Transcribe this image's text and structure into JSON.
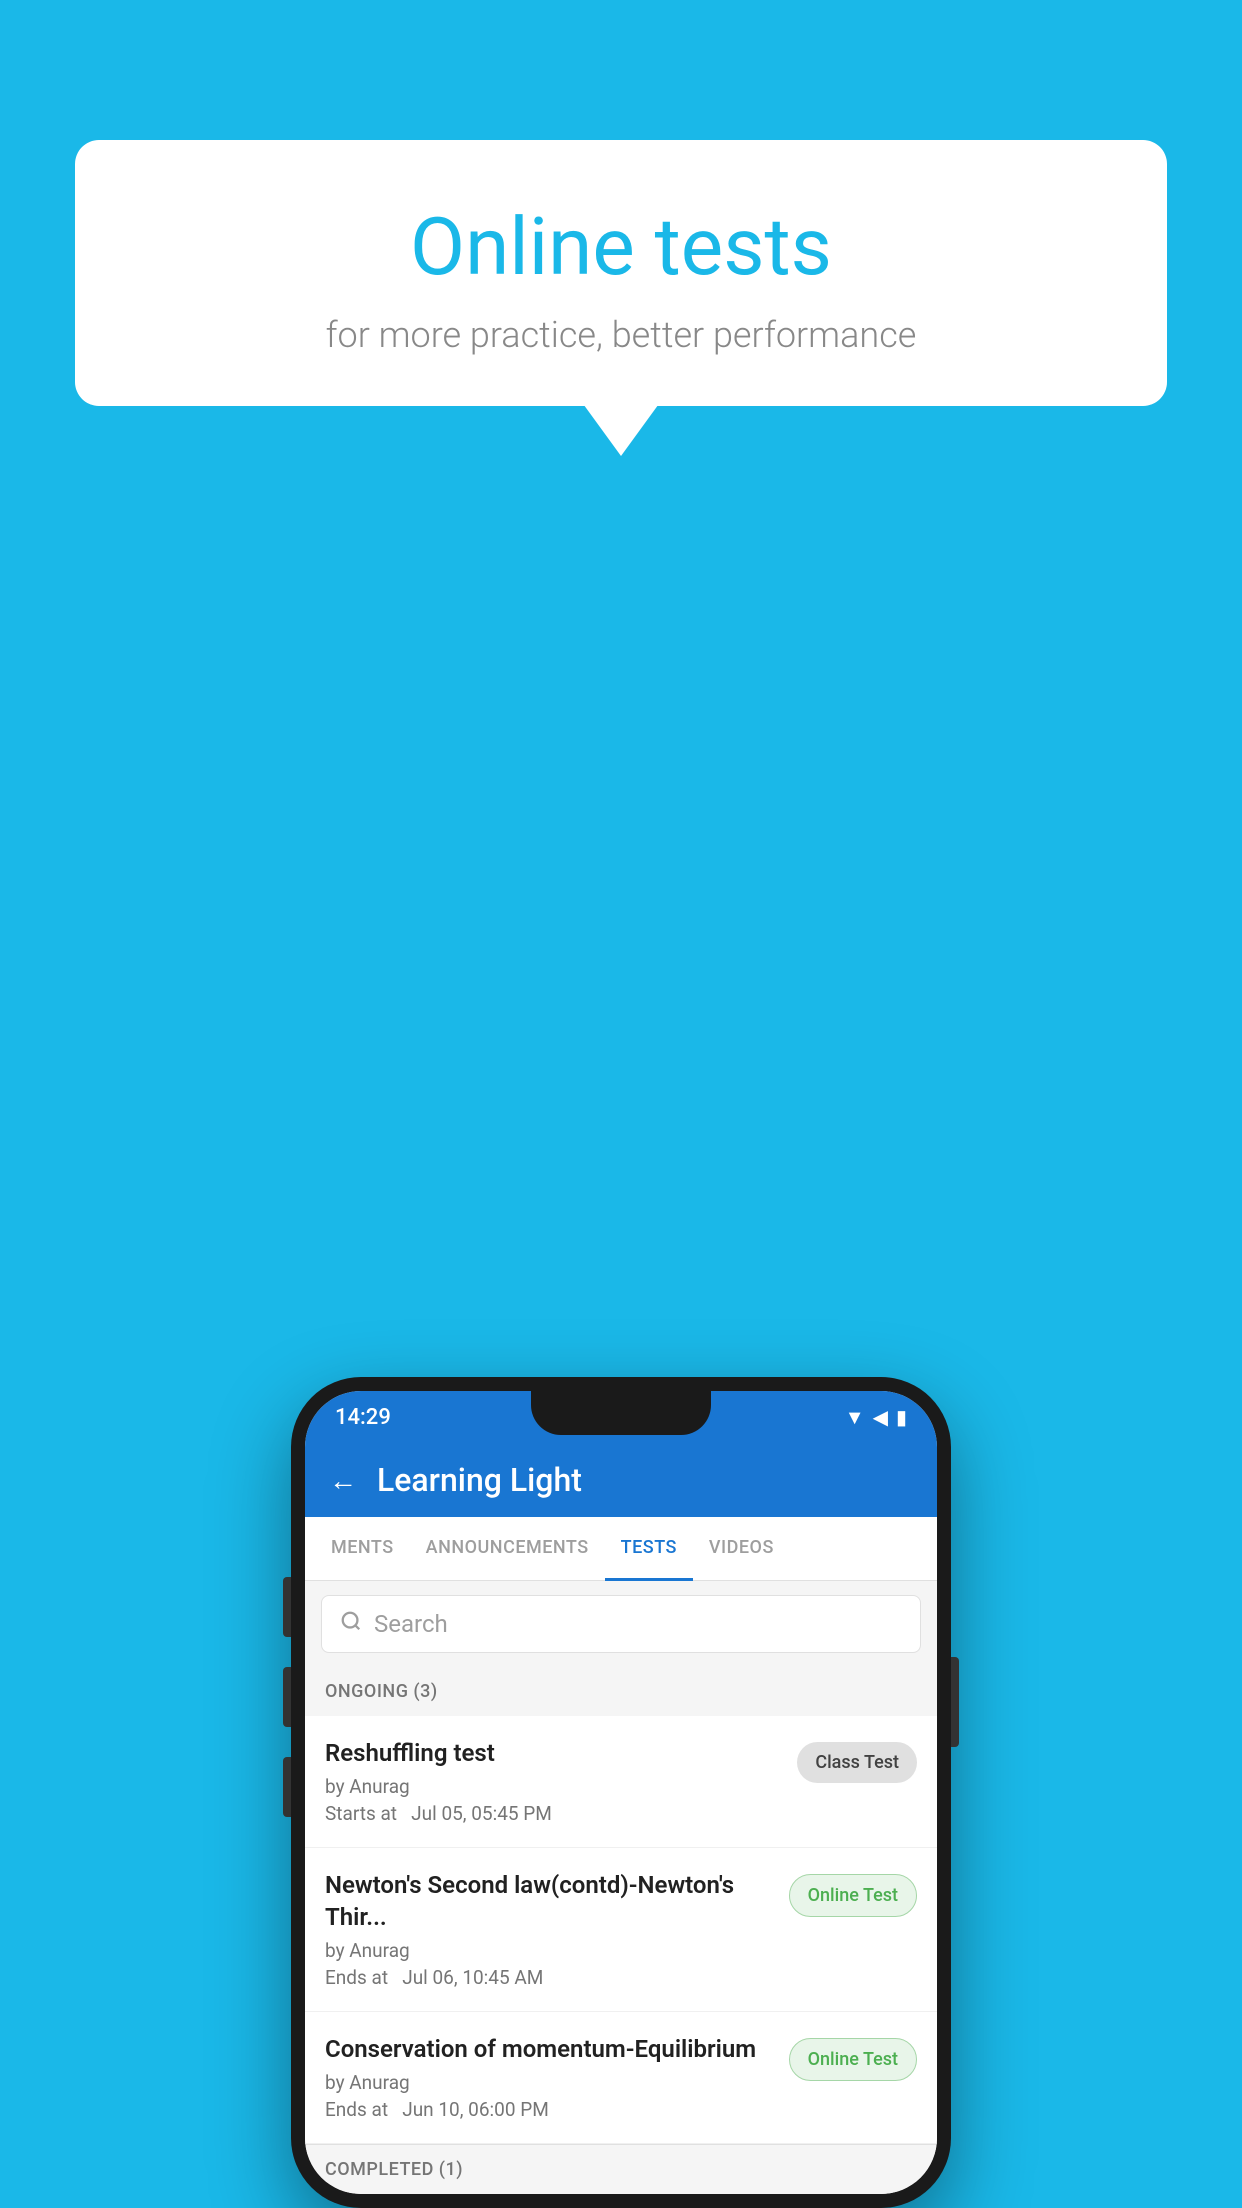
{
  "background": {
    "color": "#1ab8e8"
  },
  "speech_bubble": {
    "title": "Online tests",
    "subtitle": "for more practice, better performance"
  },
  "phone": {
    "status_bar": {
      "time": "14:29",
      "icons": "▼ ◀ ▮"
    },
    "app_header": {
      "back_label": "←",
      "title": "Learning Light"
    },
    "tabs": [
      {
        "label": "MENTS",
        "active": false
      },
      {
        "label": "ANNOUNCEMENTS",
        "active": false
      },
      {
        "label": "TESTS",
        "active": true
      },
      {
        "label": "VIDEOS",
        "active": false
      }
    ],
    "search": {
      "placeholder": "Search"
    },
    "ongoing_section": {
      "title": "ONGOING (3)"
    },
    "tests": [
      {
        "name": "Reshuffling test",
        "author": "by Anurag",
        "time": "Starts at  Jul 05, 05:45 PM",
        "badge": "Class Test",
        "badge_type": "class"
      },
      {
        "name": "Newton's Second law(contd)-Newton's Thir...",
        "author": "by Anurag",
        "time": "Ends at  Jul 06, 10:45 AM",
        "badge": "Online Test",
        "badge_type": "online"
      },
      {
        "name": "Conservation of momentum-Equilibrium",
        "author": "by Anurag",
        "time": "Ends at  Jun 10, 06:00 PM",
        "badge": "Online Test",
        "badge_type": "online"
      }
    ],
    "completed_section": {
      "title": "COMPLETED (1)"
    }
  }
}
